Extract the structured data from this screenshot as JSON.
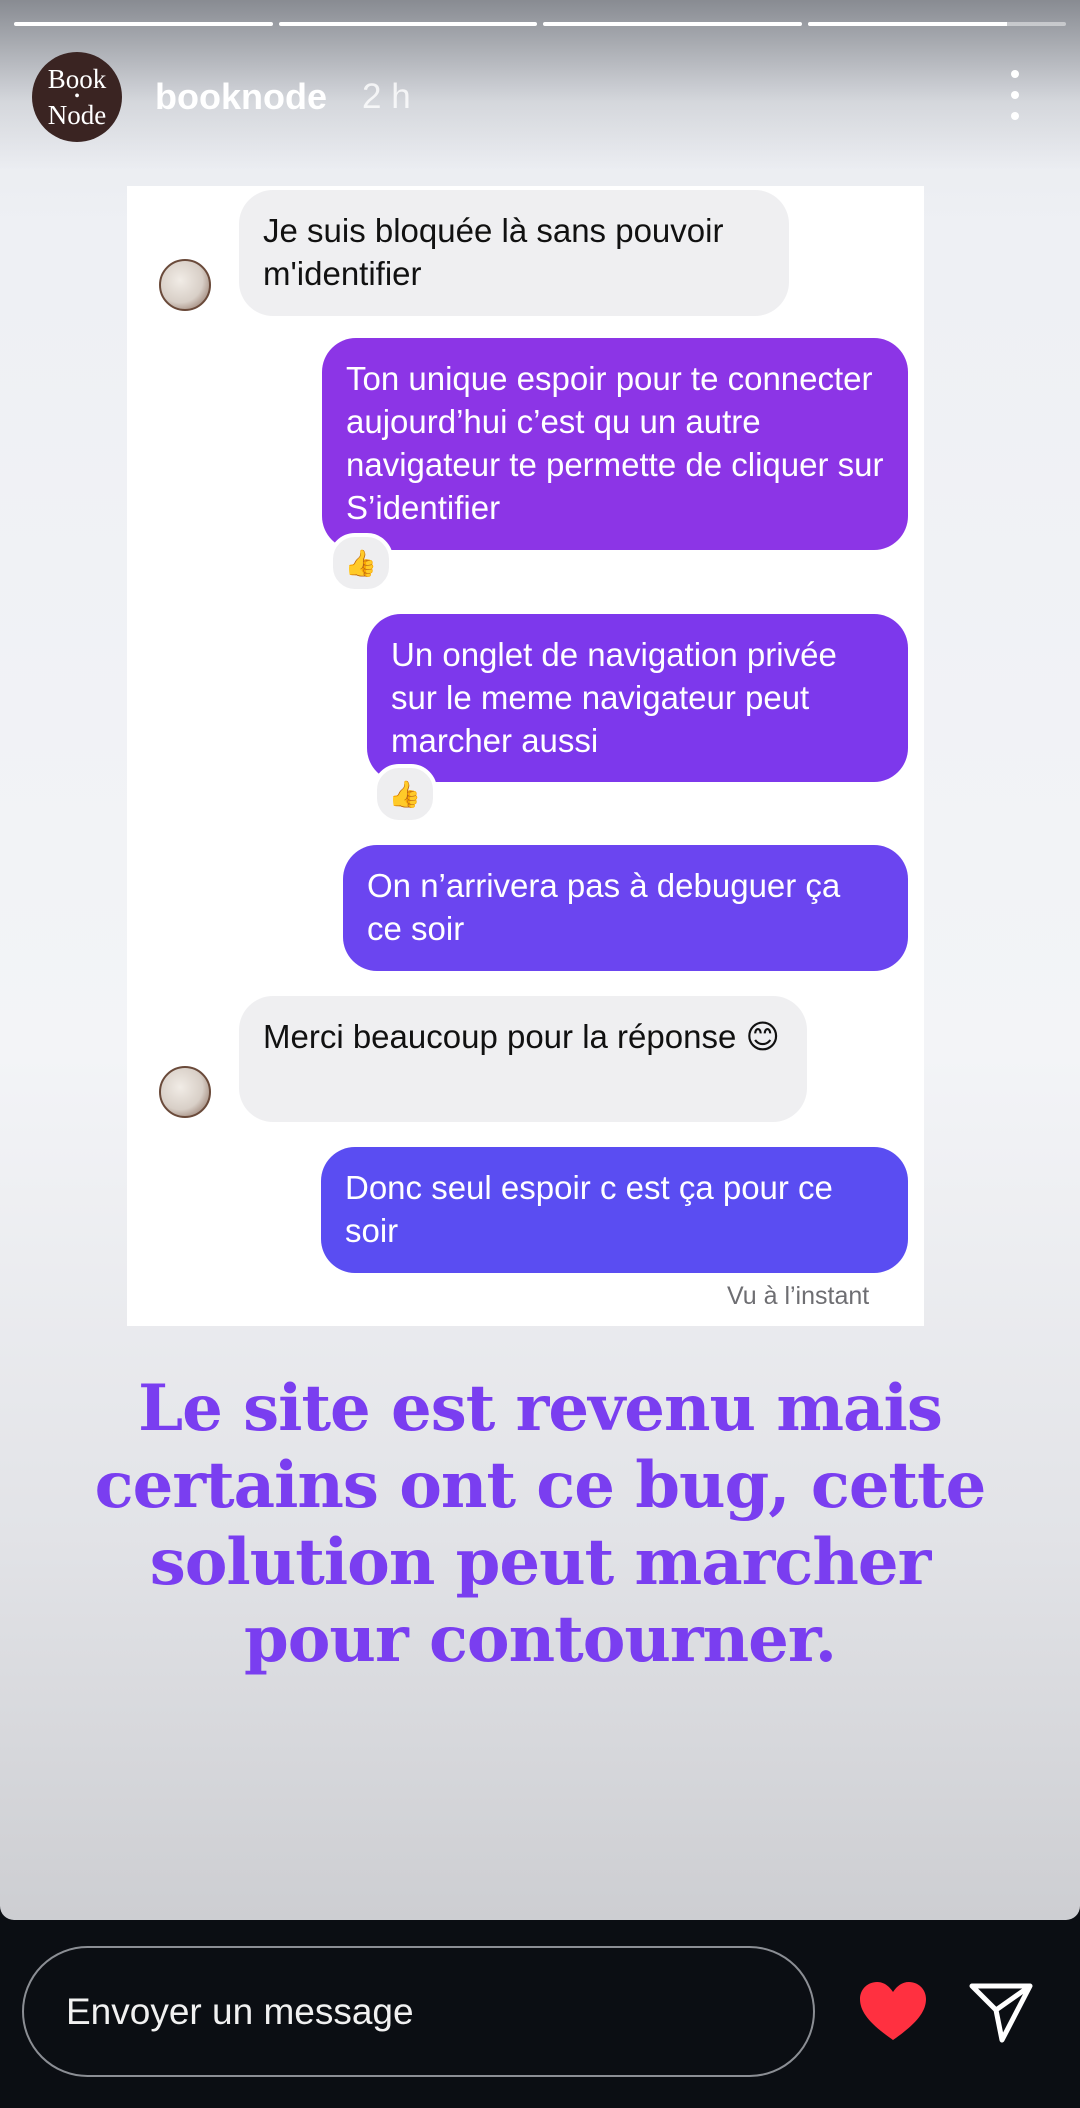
{
  "story": {
    "username": "booknode",
    "time_ago": "2 h",
    "avatar_text_line1": "Book",
    "avatar_text_dot": "•",
    "avatar_text_line2": "Node",
    "progress": [
      1,
      1,
      1,
      0.77
    ]
  },
  "chat": {
    "messages": [
      {
        "side": "in",
        "text": "Je suis bloquée là sans pouvoir m'identifier"
      },
      {
        "side": "out",
        "text": "Ton unique espoir pour te connecter aujourd’hui c’est qu un autre navigateur te permette de cliquer sur S’identifier",
        "reaction": "👍"
      },
      {
        "side": "out",
        "text": "Un onglet de navigation privée sur le meme navigateur peut marcher aussi",
        "reaction": "👍"
      },
      {
        "side": "out",
        "text": "On n’arrivera pas à debuguer ça ce soir"
      },
      {
        "side": "in",
        "text": "Merci beaucoup pour la réponse 😊"
      },
      {
        "side": "out",
        "text": "Donc seul espoir c est ça pour ce soir"
      }
    ],
    "seen": "Vu à l’instant",
    "colors": {
      "out_top": "#8c35e6",
      "out_mid": "#7a3aee",
      "out_bottom": "#5a4df2",
      "in": "#efeff1"
    }
  },
  "caption": "Le site est revenu mais certains ont ce bug, cette solution peut marcher pour contourner.",
  "reply_bar": {
    "placeholder": "Envoyer un message",
    "like_icon": "heart-icon",
    "send_icon": "send-icon",
    "accent": "#ff3040"
  }
}
